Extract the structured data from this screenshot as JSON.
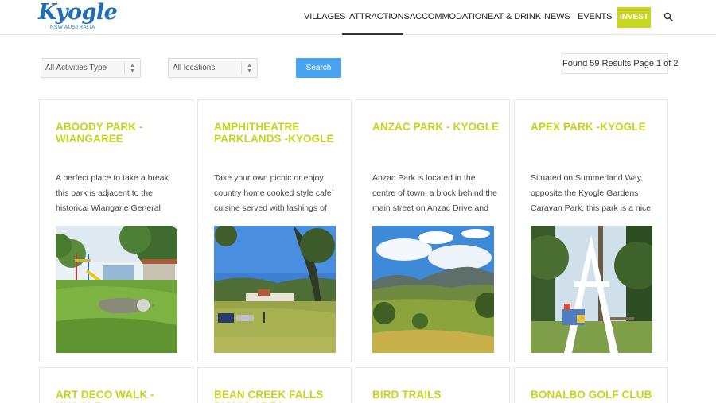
{
  "brand": {
    "name": "Kyogle",
    "sub": "NSW  AUSTRALIA",
    "color": "#1e6fb5"
  },
  "nav": {
    "items": [
      "VILLAGES",
      "ATTRACTIONS",
      "ACCOMMODATION",
      "EAT & DRINK",
      "NEWS",
      "EVENTS"
    ],
    "active": "ATTRACTIONS",
    "invest_label": "INVEST",
    "invest_color": "#c9d61e",
    "search_icon": "search-icon"
  },
  "filters": {
    "activity_type": "All Activities Type",
    "location": "All locations",
    "search_label": "Search",
    "search_color": "#4aa3f0"
  },
  "results": {
    "text": "Found 59 Results Page 1 of 2"
  },
  "accent_color": "#c5d51d",
  "cards": [
    {
      "title": "ABOODY PARK - WIANGAREE",
      "desc": "A perfect place to take a break this park is adjacent to the historical Wiangarie General Store and has"
    },
    {
      "title": "AMPHITHEATRE PARKLANDS -KYOGLE",
      "desc": "Take your own picnic or enjoy country home cooked style cafe` cuisine served with lashings of"
    },
    {
      "title": "ANZAC PARK - KYOGLE",
      "desc": "Anzac Park is located in the centre of town, a block behind the main street on Anzac Drive and near a"
    },
    {
      "title": "APEX PARK -KYOGLE",
      "desc": "Situated on Summerland Way, opposite the Kyogle Gardens Caravan Park, this park is a nice"
    },
    {
      "title": "ART DECO WALK - KYOGLE",
      "desc": ""
    },
    {
      "title": "BEAN CREEK FALLS PICNIC AREA",
      "desc": ""
    },
    {
      "title": "BIRD TRAILS",
      "desc": ""
    },
    {
      "title": "BONALBO GOLF CLUB",
      "desc": ""
    }
  ]
}
